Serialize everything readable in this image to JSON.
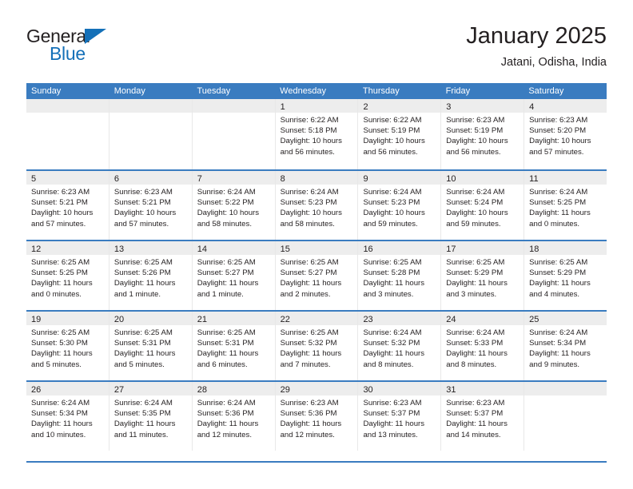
{
  "brand": {
    "name_top": "General",
    "name_bottom": "Blue",
    "accent_color": "#1470b8"
  },
  "header": {
    "title": "January 2025",
    "subtitle": "Jatani, Odisha, India"
  },
  "theme": {
    "header_bar_color": "#3a7cc0",
    "daynum_band_color": "#ededed",
    "text_color": "#231f20"
  },
  "weekdays": [
    "Sunday",
    "Monday",
    "Tuesday",
    "Wednesday",
    "Thursday",
    "Friday",
    "Saturday"
  ],
  "weeks": [
    {
      "days": [
        {
          "num": "",
          "lines": []
        },
        {
          "num": "",
          "lines": []
        },
        {
          "num": "",
          "lines": []
        },
        {
          "num": "1",
          "lines": [
            "Sunrise: 6:22 AM",
            "Sunset: 5:18 PM",
            "Daylight: 10 hours",
            "and 56 minutes."
          ]
        },
        {
          "num": "2",
          "lines": [
            "Sunrise: 6:22 AM",
            "Sunset: 5:19 PM",
            "Daylight: 10 hours",
            "and 56 minutes."
          ]
        },
        {
          "num": "3",
          "lines": [
            "Sunrise: 6:23 AM",
            "Sunset: 5:19 PM",
            "Daylight: 10 hours",
            "and 56 minutes."
          ]
        },
        {
          "num": "4",
          "lines": [
            "Sunrise: 6:23 AM",
            "Sunset: 5:20 PM",
            "Daylight: 10 hours",
            "and 57 minutes."
          ]
        }
      ]
    },
    {
      "days": [
        {
          "num": "5",
          "lines": [
            "Sunrise: 6:23 AM",
            "Sunset: 5:21 PM",
            "Daylight: 10 hours",
            "and 57 minutes."
          ]
        },
        {
          "num": "6",
          "lines": [
            "Sunrise: 6:23 AM",
            "Sunset: 5:21 PM",
            "Daylight: 10 hours",
            "and 57 minutes."
          ]
        },
        {
          "num": "7",
          "lines": [
            "Sunrise: 6:24 AM",
            "Sunset: 5:22 PM",
            "Daylight: 10 hours",
            "and 58 minutes."
          ]
        },
        {
          "num": "8",
          "lines": [
            "Sunrise: 6:24 AM",
            "Sunset: 5:23 PM",
            "Daylight: 10 hours",
            "and 58 minutes."
          ]
        },
        {
          "num": "9",
          "lines": [
            "Sunrise: 6:24 AM",
            "Sunset: 5:23 PM",
            "Daylight: 10 hours",
            "and 59 minutes."
          ]
        },
        {
          "num": "10",
          "lines": [
            "Sunrise: 6:24 AM",
            "Sunset: 5:24 PM",
            "Daylight: 10 hours",
            "and 59 minutes."
          ]
        },
        {
          "num": "11",
          "lines": [
            "Sunrise: 6:24 AM",
            "Sunset: 5:25 PM",
            "Daylight: 11 hours",
            "and 0 minutes."
          ]
        }
      ]
    },
    {
      "days": [
        {
          "num": "12",
          "lines": [
            "Sunrise: 6:25 AM",
            "Sunset: 5:25 PM",
            "Daylight: 11 hours",
            "and 0 minutes."
          ]
        },
        {
          "num": "13",
          "lines": [
            "Sunrise: 6:25 AM",
            "Sunset: 5:26 PM",
            "Daylight: 11 hours",
            "and 1 minute."
          ]
        },
        {
          "num": "14",
          "lines": [
            "Sunrise: 6:25 AM",
            "Sunset: 5:27 PM",
            "Daylight: 11 hours",
            "and 1 minute."
          ]
        },
        {
          "num": "15",
          "lines": [
            "Sunrise: 6:25 AM",
            "Sunset: 5:27 PM",
            "Daylight: 11 hours",
            "and 2 minutes."
          ]
        },
        {
          "num": "16",
          "lines": [
            "Sunrise: 6:25 AM",
            "Sunset: 5:28 PM",
            "Daylight: 11 hours",
            "and 3 minutes."
          ]
        },
        {
          "num": "17",
          "lines": [
            "Sunrise: 6:25 AM",
            "Sunset: 5:29 PM",
            "Daylight: 11 hours",
            "and 3 minutes."
          ]
        },
        {
          "num": "18",
          "lines": [
            "Sunrise: 6:25 AM",
            "Sunset: 5:29 PM",
            "Daylight: 11 hours",
            "and 4 minutes."
          ]
        }
      ]
    },
    {
      "days": [
        {
          "num": "19",
          "lines": [
            "Sunrise: 6:25 AM",
            "Sunset: 5:30 PM",
            "Daylight: 11 hours",
            "and 5 minutes."
          ]
        },
        {
          "num": "20",
          "lines": [
            "Sunrise: 6:25 AM",
            "Sunset: 5:31 PM",
            "Daylight: 11 hours",
            "and 5 minutes."
          ]
        },
        {
          "num": "21",
          "lines": [
            "Sunrise: 6:25 AM",
            "Sunset: 5:31 PM",
            "Daylight: 11 hours",
            "and 6 minutes."
          ]
        },
        {
          "num": "22",
          "lines": [
            "Sunrise: 6:25 AM",
            "Sunset: 5:32 PM",
            "Daylight: 11 hours",
            "and 7 minutes."
          ]
        },
        {
          "num": "23",
          "lines": [
            "Sunrise: 6:24 AM",
            "Sunset: 5:32 PM",
            "Daylight: 11 hours",
            "and 8 minutes."
          ]
        },
        {
          "num": "24",
          "lines": [
            "Sunrise: 6:24 AM",
            "Sunset: 5:33 PM",
            "Daylight: 11 hours",
            "and 8 minutes."
          ]
        },
        {
          "num": "25",
          "lines": [
            "Sunrise: 6:24 AM",
            "Sunset: 5:34 PM",
            "Daylight: 11 hours",
            "and 9 minutes."
          ]
        }
      ]
    },
    {
      "days": [
        {
          "num": "26",
          "lines": [
            "Sunrise: 6:24 AM",
            "Sunset: 5:34 PM",
            "Daylight: 11 hours",
            "and 10 minutes."
          ]
        },
        {
          "num": "27",
          "lines": [
            "Sunrise: 6:24 AM",
            "Sunset: 5:35 PM",
            "Daylight: 11 hours",
            "and 11 minutes."
          ]
        },
        {
          "num": "28",
          "lines": [
            "Sunrise: 6:24 AM",
            "Sunset: 5:36 PM",
            "Daylight: 11 hours",
            "and 12 minutes."
          ]
        },
        {
          "num": "29",
          "lines": [
            "Sunrise: 6:23 AM",
            "Sunset: 5:36 PM",
            "Daylight: 11 hours",
            "and 12 minutes."
          ]
        },
        {
          "num": "30",
          "lines": [
            "Sunrise: 6:23 AM",
            "Sunset: 5:37 PM",
            "Daylight: 11 hours",
            "and 13 minutes."
          ]
        },
        {
          "num": "31",
          "lines": [
            "Sunrise: 6:23 AM",
            "Sunset: 5:37 PM",
            "Daylight: 11 hours",
            "and 14 minutes."
          ]
        },
        {
          "num": "",
          "lines": []
        }
      ]
    }
  ]
}
